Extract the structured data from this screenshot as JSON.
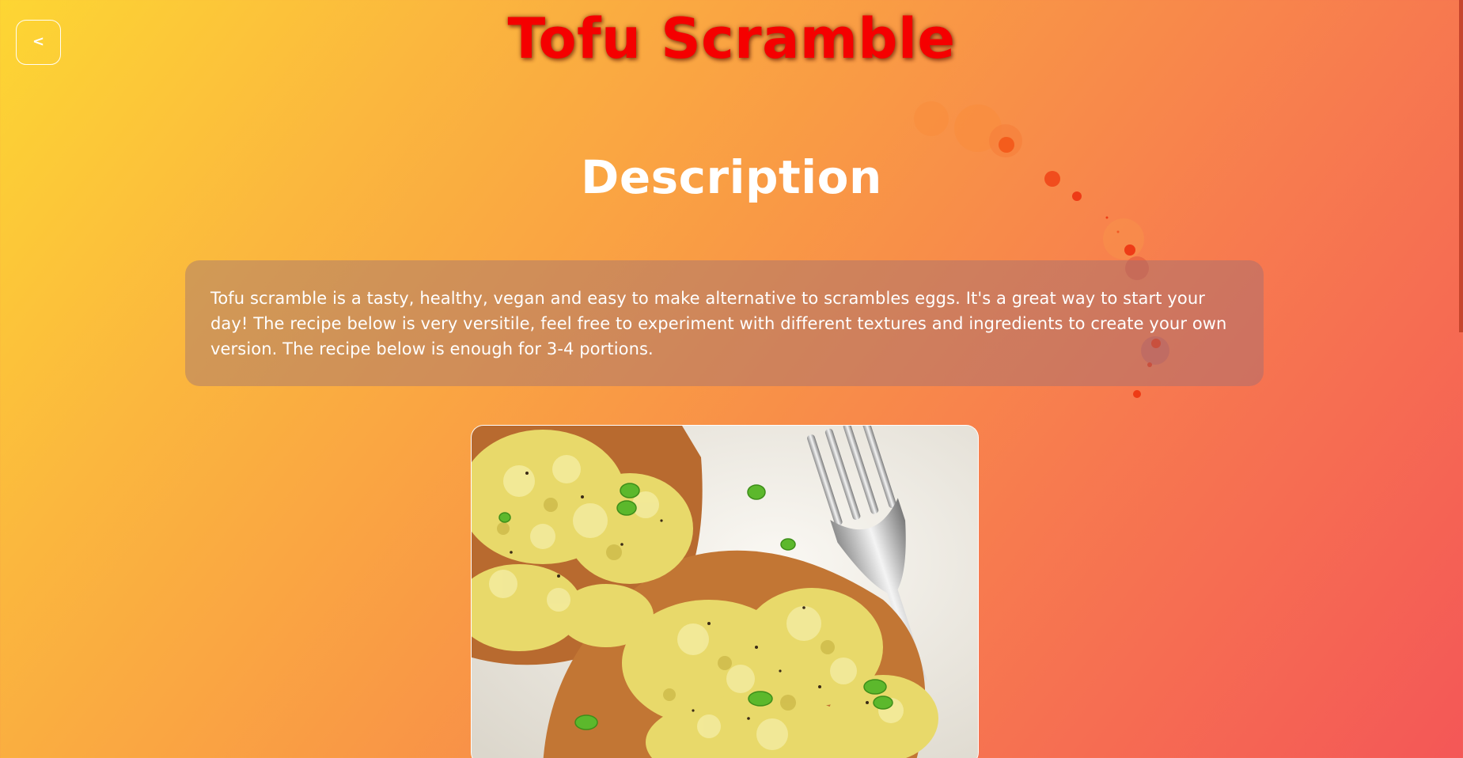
{
  "header": {
    "back_icon": "chevron-left-icon",
    "back_glyph": "<",
    "title": "Tofu Scramble"
  },
  "description": {
    "heading": "Description",
    "text": "Tofu scramble is a tasty, healthy, vegan and easy to make alternative to scrambles eggs. It's a great way to start your day! The recipe below is very versitile, feel free to experiment with different textures and ingredients to create your own version. The recipe below is enough for 3-4 portions."
  },
  "colors": {
    "title": "#f50000",
    "gradient_start": "#fdd633",
    "gradient_end": "#f45757",
    "card_background": "rgba(150,110,120,0.42)"
  }
}
